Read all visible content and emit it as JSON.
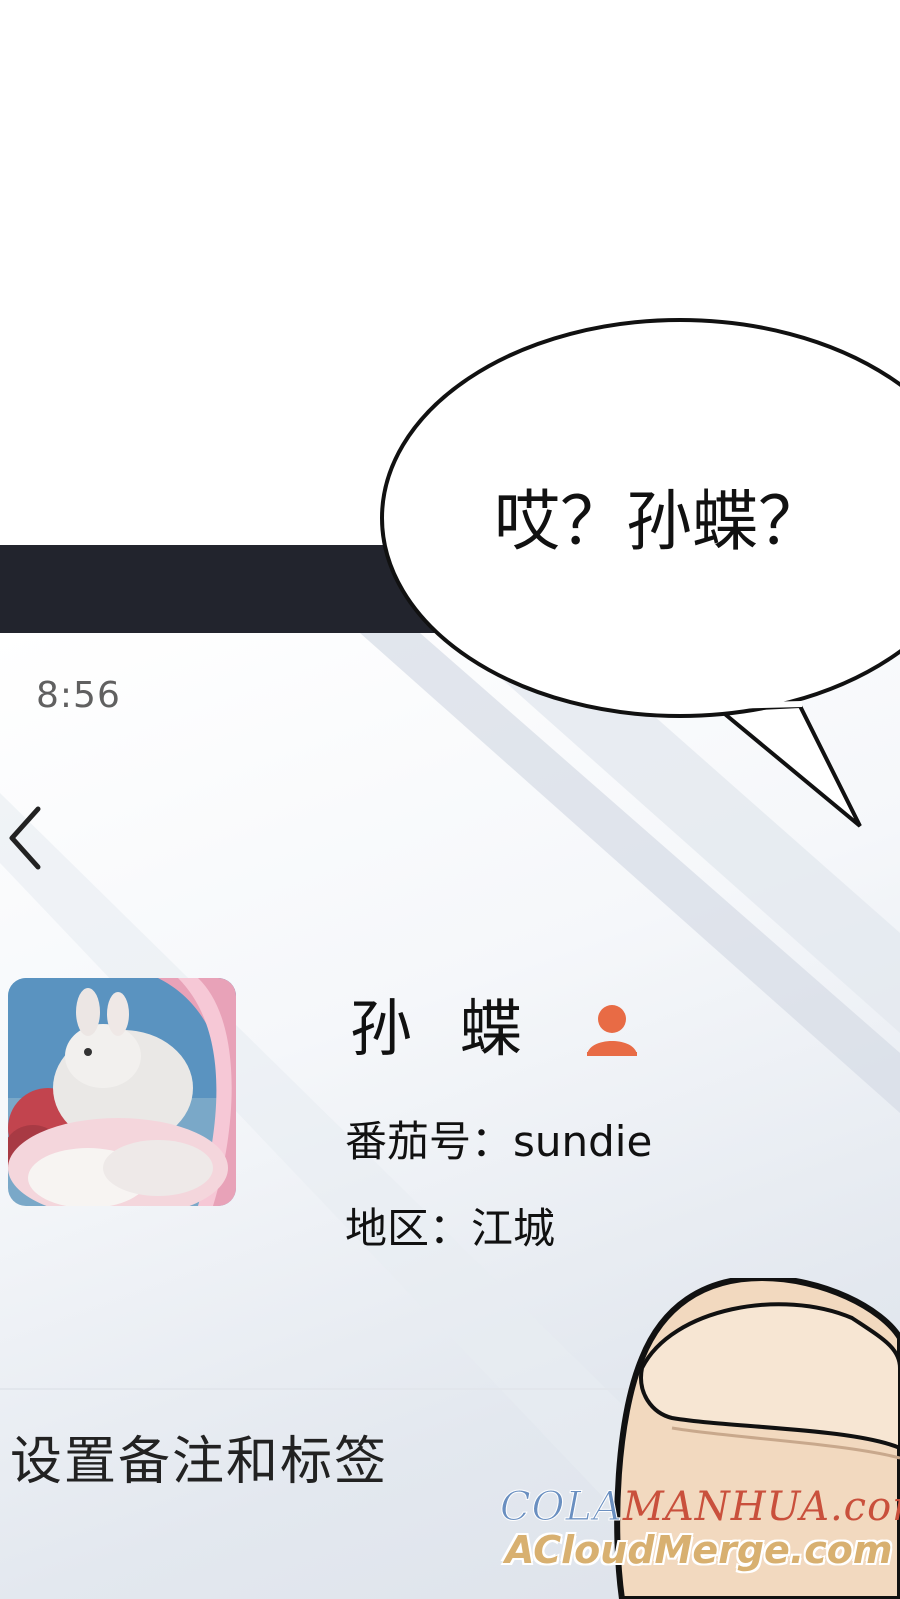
{
  "speech_bubble": {
    "text": "哎？孙蝶？"
  },
  "phone": {
    "status_time": "8:56",
    "profile": {
      "name": "孙 蝶",
      "id_label": "番茄号：",
      "id_value": "sundie",
      "region_label": "地区：",
      "region_value": "江城"
    },
    "remark_label": "设置备注和标签"
  },
  "watermark": {
    "line1_a": "COLA",
    "line1_b": "MANHUA",
    "line1_c": ".com",
    "line2": "ACloudMerge.com"
  },
  "colors": {
    "bezel": "#22242d",
    "contact_icon": "#e86b45",
    "watermark_blue": "#6a8fc0",
    "watermark_red": "#c9503c",
    "watermark_gold": "#d8b070"
  }
}
